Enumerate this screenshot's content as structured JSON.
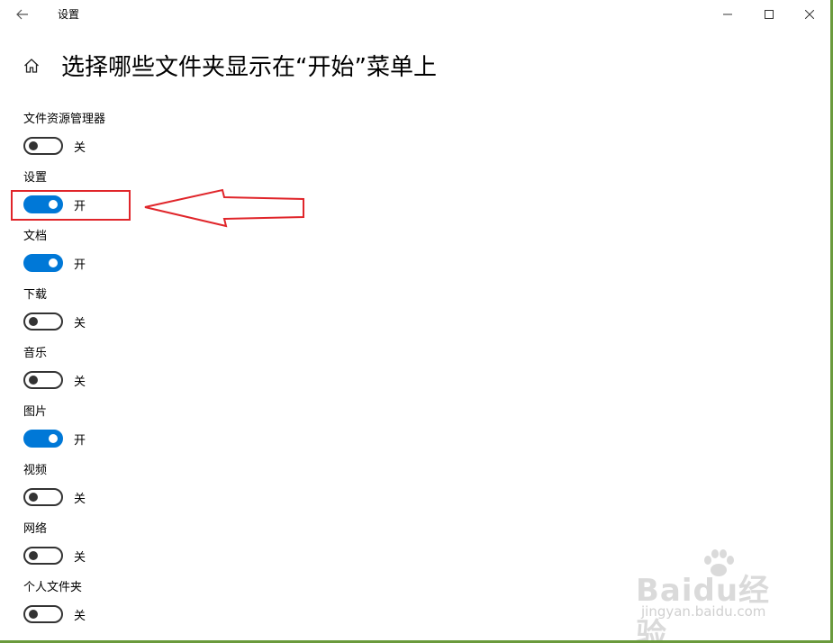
{
  "window": {
    "title": "设置",
    "controls": {
      "minimize": "minimize-icon",
      "maximize": "maximize-icon",
      "close": "close-icon"
    }
  },
  "page": {
    "title": "选择哪些文件夹显示在“开始”菜单上"
  },
  "settings": [
    {
      "label": "文件资源管理器",
      "state": "关",
      "on": false
    },
    {
      "label": "设置",
      "state": "开",
      "on": true
    },
    {
      "label": "文档",
      "state": "开",
      "on": true
    },
    {
      "label": "下载",
      "state": "关",
      "on": false
    },
    {
      "label": "音乐",
      "state": "关",
      "on": false
    },
    {
      "label": "图片",
      "state": "开",
      "on": true
    },
    {
      "label": "视频",
      "state": "关",
      "on": false
    },
    {
      "label": "网络",
      "state": "关",
      "on": false
    },
    {
      "label": "个人文件夹",
      "state": "关",
      "on": false
    }
  ],
  "annotation": {
    "color": "#e0252a",
    "target": "设置"
  },
  "watermark": {
    "logo": "Baidu经验",
    "url": "jingyan.baidu.com"
  },
  "colors": {
    "accent": "#0078d7",
    "desktop": "#6a9a3c"
  }
}
